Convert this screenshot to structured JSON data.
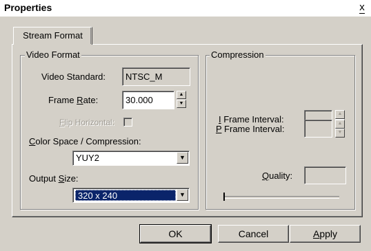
{
  "window": {
    "title": "Properties",
    "close_glyph": "x"
  },
  "tabs": [
    {
      "label": "Stream Format"
    }
  ],
  "video_format": {
    "group_label": "Video Format",
    "video_standard": {
      "label": "Video Standard:",
      "value": "NTSC_M"
    },
    "frame_rate": {
      "label_pre": "Frame ",
      "label_key": "R",
      "label_post": "ate:",
      "value": "30.000"
    },
    "flip_horizontal": {
      "label_key": "F",
      "label_post": "lip Horizontal:",
      "checked": false
    },
    "color_space": {
      "label_key": "C",
      "label_post": "olor Space / Compression:",
      "value": "YUY2"
    },
    "output_size": {
      "label_pre": "Output ",
      "label_key": "S",
      "label_post": "ize:",
      "value": "320 x 240"
    }
  },
  "compression": {
    "group_label": "Compression",
    "i_frame": {
      "label_key": "I",
      "label_post": " Frame Interval:",
      "value": ""
    },
    "p_frame": {
      "label_key": "P",
      "label_post": " Frame Interval:",
      "value": ""
    },
    "quality": {
      "label_key": "Q",
      "label_post": "uality:",
      "value": ""
    }
  },
  "buttons": {
    "ok": "OK",
    "cancel": "Cancel",
    "apply_key": "A",
    "apply_post": "pply"
  }
}
